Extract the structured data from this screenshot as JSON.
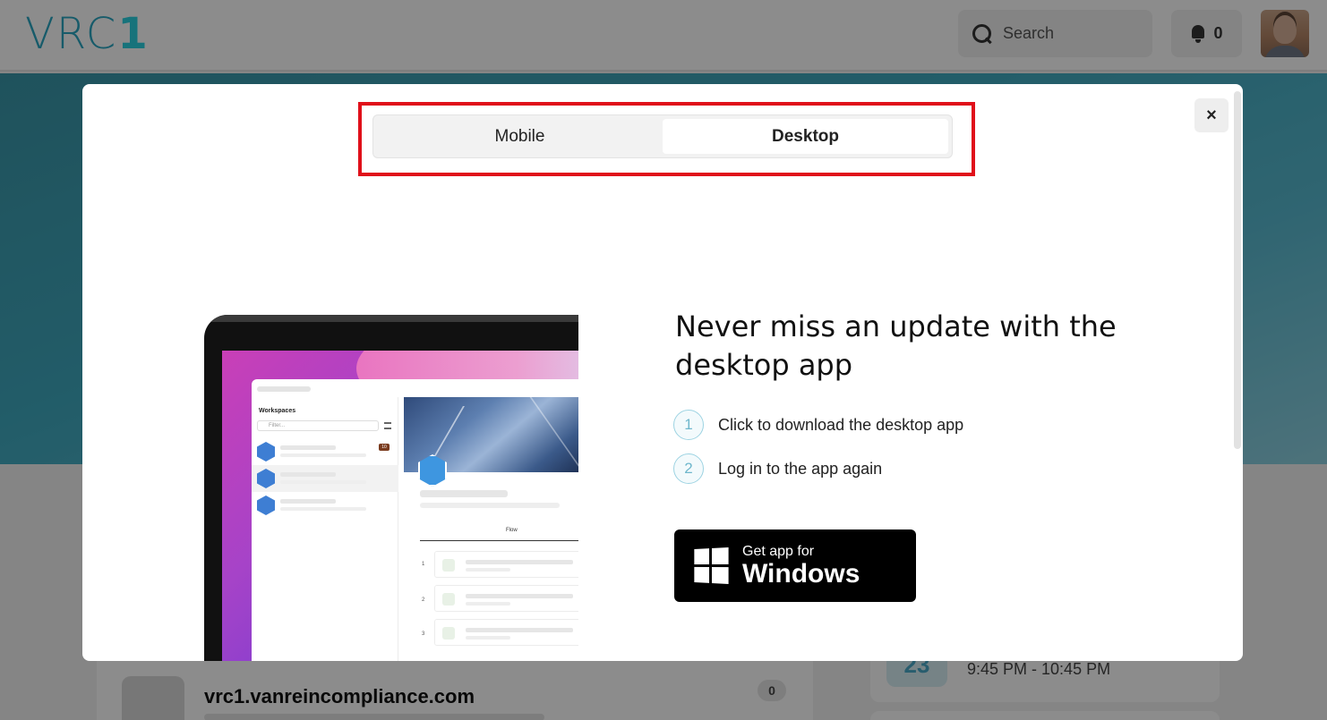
{
  "header": {
    "logo_text": "VRC",
    "logo_accent": "1",
    "search_placeholder": "Search",
    "notification_count": "0"
  },
  "background": {
    "site_name": "vrc1.vanreincompliance.com",
    "site_count": "0",
    "event_day": "23",
    "event_time": "9:45 PM - 10:45 PM"
  },
  "modal": {
    "close_label": "×",
    "tabs": [
      {
        "label": "Mobile",
        "active": false
      },
      {
        "label": "Desktop",
        "active": true
      }
    ],
    "headline": "Never miss an update with the desktop app",
    "steps": [
      {
        "num": "1",
        "text": "Click to download the desktop app"
      },
      {
        "num": "2",
        "text": "Log in to the app again"
      }
    ],
    "download_button": {
      "small": "Get app for",
      "big": "Windows"
    },
    "illustration": {
      "workspaces_title": "Workspaces",
      "filter_placeholder": "Filter...",
      "badge": "10",
      "flow_label": "Flow",
      "flow_numbers": [
        "1",
        "2",
        "3"
      ]
    }
  },
  "colors": {
    "accent": "#2aa6c2",
    "highlight_border": "#e0101a",
    "button_bg": "#000000"
  }
}
